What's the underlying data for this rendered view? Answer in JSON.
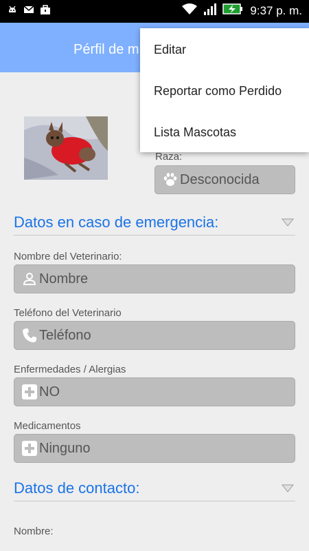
{
  "status_bar": {
    "time": "9:37 p. m.",
    "left_icons": [
      "android-debug-icon",
      "mail-icon",
      "briefcase-icon"
    ],
    "right_icons": [
      "wifi-icon",
      "signal-icon",
      "battery-charging-icon"
    ]
  },
  "app_bar": {
    "title": "Pérfil de m"
  },
  "overflow_menu": {
    "items": [
      {
        "label": "Editar"
      },
      {
        "label": "Reportar como Perdido"
      },
      {
        "label": "Lista Mascotas"
      }
    ]
  },
  "pet": {
    "photo": "pet-photo",
    "breed_label": "Raza:",
    "breed_value": "Desconocida",
    "breed_icon": "paw-icon"
  },
  "emergency": {
    "title": "Datos en caso de emergencia:",
    "vet_name_label": "Nombre del Veterinario:",
    "vet_name_placeholder": "Nombre",
    "vet_phone_label": "Teléfono del Veterinario",
    "vet_phone_placeholder": "Teléfono",
    "illness_label": "Enfermedades / Alergias",
    "illness_value": "NO",
    "meds_label": "Medicamentos",
    "meds_value": "Ninguno"
  },
  "contact": {
    "title": "Datos de contacto:",
    "name_label": "Nombre:"
  },
  "colors": {
    "app_bar": "#7fb0ff",
    "section_title": "#1a73e8",
    "field_bg": "#bdbdbd",
    "background": "#eeeeee"
  }
}
